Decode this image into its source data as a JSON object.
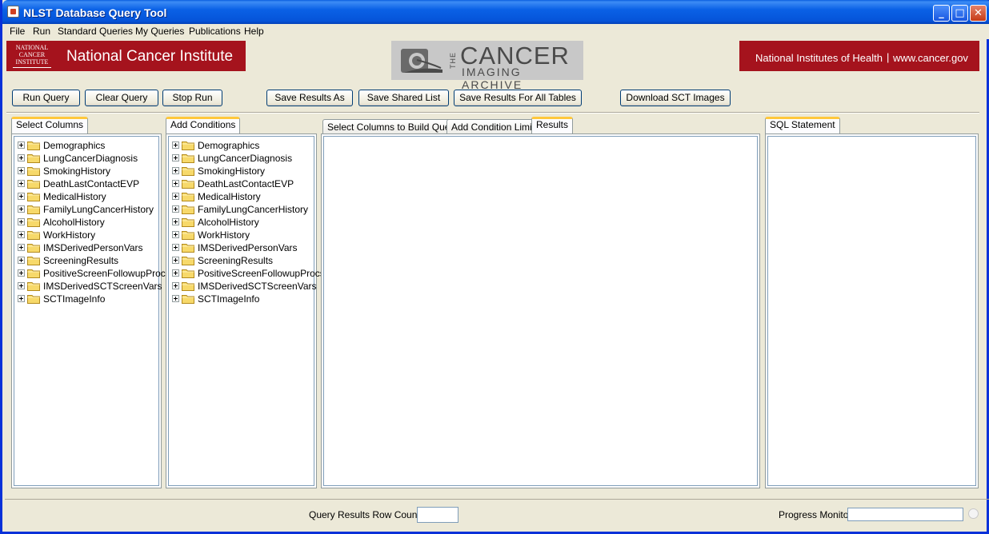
{
  "window": {
    "title": "NLST Database Query Tool"
  },
  "menu": [
    "File",
    "Run",
    "Standard Queries",
    "My Queries",
    "Publications",
    "Help"
  ],
  "banner": {
    "nci_logo_text": "NATIONAL CANCER INSTITUTE",
    "nci_name": "National Cancer Institute",
    "tcia_the": "THE",
    "tcia_cancer": "CANCER",
    "tcia_archive": "IMAGING ARCHIVE",
    "nih": "National Institutes of Health",
    "separator": "|",
    "url": "www.cancer.gov"
  },
  "toolbar": {
    "run_query": "Run Query",
    "clear_query": "Clear Query",
    "stop_run": "Stop Run",
    "save_results_as": "Save Results As",
    "save_shared_list": "Save Shared List",
    "save_results_all": "Save Results For All Tables",
    "download_sct": "Download SCT Images"
  },
  "tabs": {
    "select_columns": "Select Columns",
    "add_conditions": "Add Conditions",
    "build_query": "Select Columns to Build Query",
    "condition_limits": "Add Condition Limits",
    "results": "Results",
    "sql_statement": "SQL Statement"
  },
  "tree_items": [
    "Demographics",
    "LungCancerDiagnosis",
    "SmokingHistory",
    "DeathLastContactEVP",
    "MedicalHistory",
    "FamilyLungCancerHistory",
    "AlcoholHistory",
    "WorkHistory",
    "IMSDerivedPersonVars",
    "ScreeningResults",
    "PositiveScreenFollowupProcs",
    "IMSDerivedSCTScreenVars",
    "SCTImageInfo"
  ],
  "status": {
    "row_count_label": "Query Results Row Count",
    "row_count_value": "",
    "progress_label": "Progress Monitor"
  },
  "colors": {
    "title_blue": "#0a61e6",
    "nci_red": "#a5131d",
    "tab_accent": "#ffc83c"
  }
}
